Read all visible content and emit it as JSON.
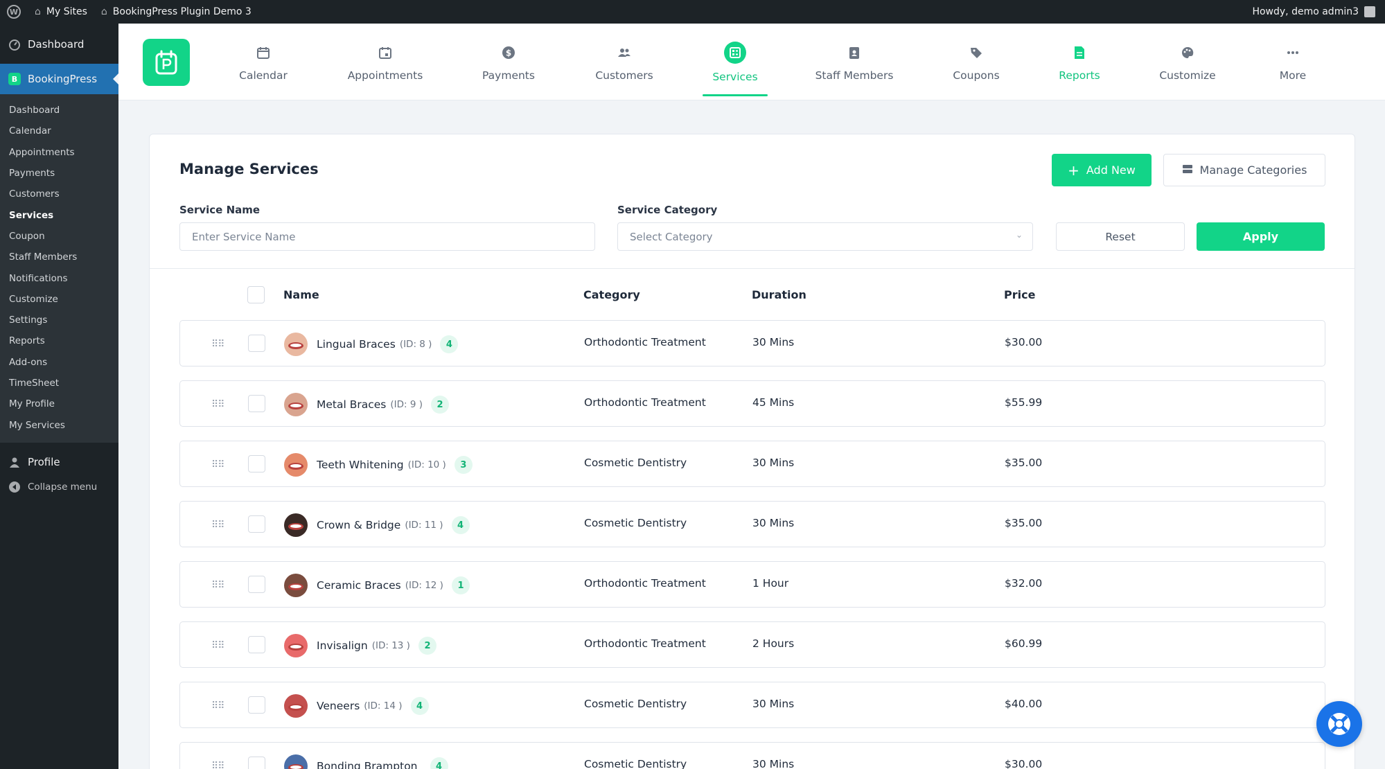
{
  "admin_bar": {
    "my_sites": "My Sites",
    "site_name": "BookingPress Plugin Demo 3",
    "greeting": "Howdy, demo admin3"
  },
  "wp_menu": {
    "dashboard": "Dashboard",
    "bookingpress": "BookingPress",
    "submenu": [
      "Dashboard",
      "Calendar",
      "Appointments",
      "Payments",
      "Customers",
      "Services",
      "Coupon",
      "Staff Members",
      "Notifications",
      "Customize",
      "Settings",
      "Reports",
      "Add-ons",
      "TimeSheet",
      "My Profile",
      "My Services"
    ],
    "active_index": 5,
    "profile": "Profile",
    "collapse": "Collapse menu"
  },
  "topnav": {
    "items": [
      {
        "label": "Calendar",
        "icon": "calendar-icon"
      },
      {
        "label": "Appointments",
        "icon": "calendar-check-icon"
      },
      {
        "label": "Payments",
        "icon": "dollar-icon"
      },
      {
        "label": "Customers",
        "icon": "users-icon"
      },
      {
        "label": "Services",
        "icon": "services-icon"
      },
      {
        "label": "Staff Members",
        "icon": "id-badge-icon"
      },
      {
        "label": "Coupons",
        "icon": "tag-icon"
      },
      {
        "label": "Reports",
        "icon": "report-icon"
      },
      {
        "label": "Customize",
        "icon": "palette-icon"
      },
      {
        "label": "More",
        "icon": "more-icon"
      }
    ],
    "active": "Services",
    "accent": "#12d488"
  },
  "page": {
    "title": "Manage Services",
    "add_new": "Add New",
    "manage_categories": "Manage Categories",
    "filters": {
      "service_name_label": "Service Name",
      "service_name_placeholder": "Enter Service Name",
      "category_label": "Service Category",
      "category_placeholder": "Select Category",
      "reset": "Reset",
      "apply": "Apply"
    }
  },
  "table": {
    "headers": {
      "name": "Name",
      "category": "Category",
      "duration": "Duration",
      "price": "Price"
    },
    "rows": [
      {
        "name": "Lingual Braces",
        "id": "(ID: 8 )",
        "count": "4",
        "category": "Orthodontic Treatment",
        "duration": "30 Mins",
        "price": "$30.00",
        "tone": "#e9b8a0"
      },
      {
        "name": "Metal Braces",
        "id": "(ID: 9 )",
        "count": "2",
        "category": "Orthodontic Treatment",
        "duration": "45 Mins",
        "price": "$55.99",
        "tone": "#d9a48f"
      },
      {
        "name": "Teeth Whitening",
        "id": "(ID: 10 )",
        "count": "3",
        "category": "Cosmetic Dentistry",
        "duration": "30 Mins",
        "price": "$35.00",
        "tone": "#e58a6a"
      },
      {
        "name": "Crown & Bridge",
        "id": "(ID: 11 )",
        "count": "4",
        "category": "Cosmetic Dentistry",
        "duration": "30 Mins",
        "price": "$35.00",
        "tone": "#3a2a26"
      },
      {
        "name": "Ceramic Braces",
        "id": "(ID: 12 )",
        "count": "1",
        "category": "Orthodontic Treatment",
        "duration": "1 Hour",
        "price": "$32.00",
        "tone": "#7a4c3e"
      },
      {
        "name": "Invisalign",
        "id": "(ID: 13 )",
        "count": "2",
        "category": "Orthodontic Treatment",
        "duration": "2 Hours",
        "price": "$60.99",
        "tone": "#e86a6a"
      },
      {
        "name": "Veneers",
        "id": "(ID: 14 )",
        "count": "4",
        "category": "Cosmetic Dentistry",
        "duration": "30 Mins",
        "price": "$40.00",
        "tone": "#c4504e"
      },
      {
        "name": "Bonding Brampton",
        "id": "",
        "count": "4",
        "category": "Cosmetic Dentistry",
        "duration": "30 Mins",
        "price": "$30.00",
        "tone": "#4a6ea8"
      }
    ]
  }
}
